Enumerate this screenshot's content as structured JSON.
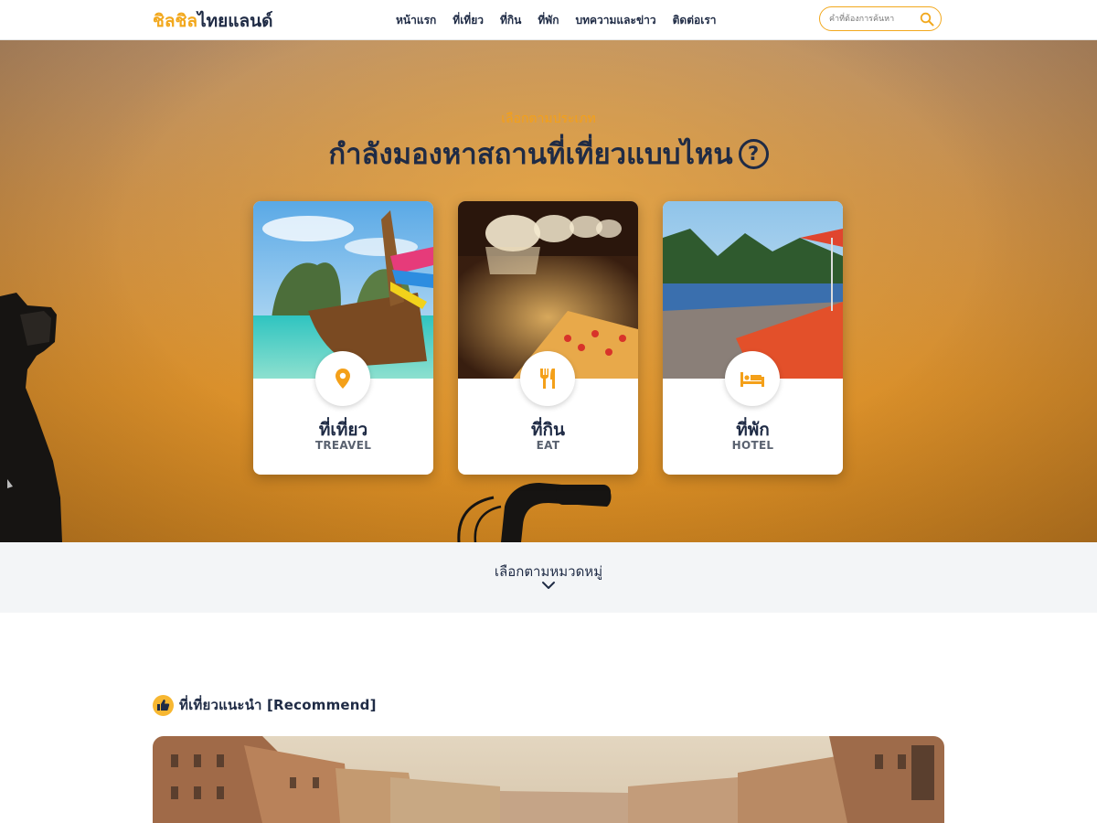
{
  "header": {
    "logo_part1": "ชิลชิล",
    "logo_part2": "ไทยแลนด์",
    "nav": [
      "หน้าแรก",
      "ที่เที่ยว",
      "ที่กิน",
      "ที่พัก",
      "บทความและข่าว",
      "ติดต่อเรา"
    ],
    "search_placeholder": "คำที่ต้องการค้นหา",
    "search_icon": "search-icon"
  },
  "hero": {
    "subtitle": "เลือกตามประเภท",
    "title": "กำลังมองหาสถานที่เที่ยวแบบไหน",
    "question_mark": "?",
    "cards": [
      {
        "title": "ที่เที่ยว",
        "subtitle": "TREAVEL",
        "icon": "map-pin-icon"
      },
      {
        "title": "ที่กิน",
        "subtitle": "EAT",
        "icon": "fork-knife-icon"
      },
      {
        "title": "ที่พัก",
        "subtitle": "HOTEL",
        "icon": "bed-icon"
      }
    ]
  },
  "category": {
    "label": "เลือกตามหมวดหมู่",
    "icon": "chevron-down-icon"
  },
  "recommend": {
    "title": "ที่เที่ยวแนะนำ [Recommend]",
    "icon": "thumbs-up-icon"
  },
  "colors": {
    "accent": "#f2a81d",
    "navy": "#1f2b45",
    "strip_bg": "#f3f5f7"
  }
}
